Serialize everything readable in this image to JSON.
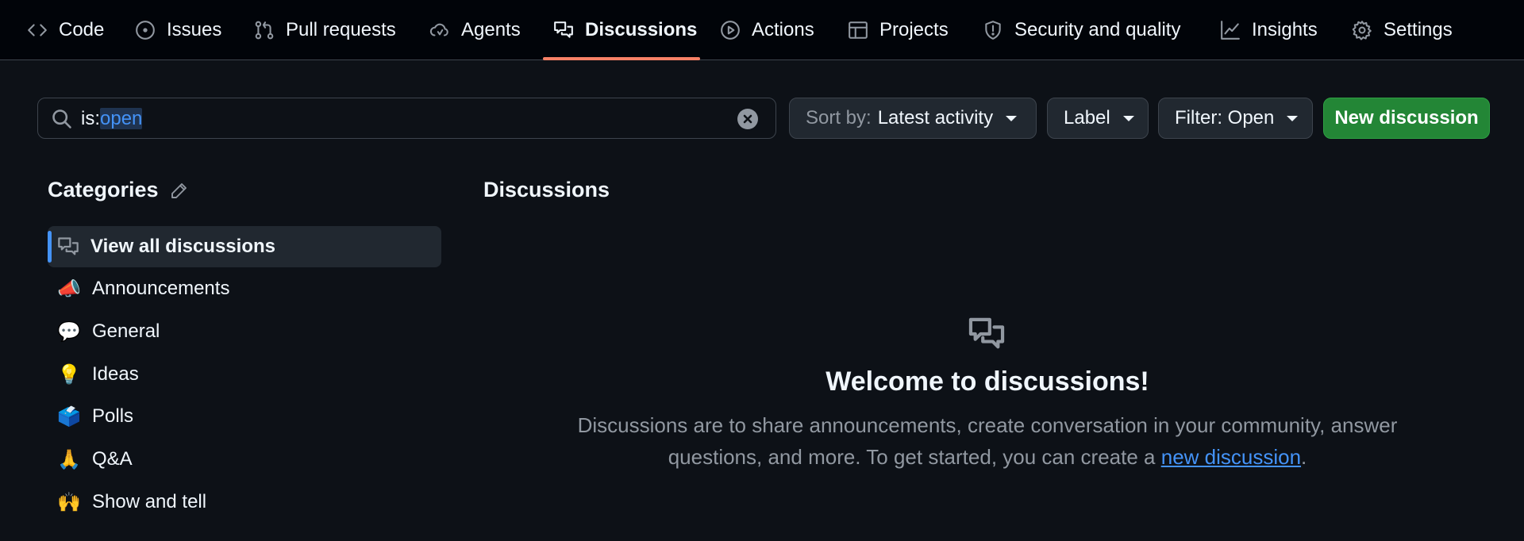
{
  "repo_nav": {
    "tabs": [
      {
        "label": "Code",
        "icon": "code-icon"
      },
      {
        "label": "Issues",
        "icon": "issue-opened-icon"
      },
      {
        "label": "Pull requests",
        "icon": "git-pull-request-icon"
      },
      {
        "label": "Agents",
        "icon": "agent-cloud-icon"
      },
      {
        "label": "Discussions",
        "icon": "comment-discussion-icon",
        "active": true
      },
      {
        "label": "Actions",
        "icon": "play-icon"
      },
      {
        "label": "Projects",
        "icon": "table-icon"
      },
      {
        "label": "Security and quality",
        "icon": "shield-icon"
      },
      {
        "label": "Insights",
        "icon": "graph-icon"
      },
      {
        "label": "Settings",
        "icon": "gear-icon"
      }
    ]
  },
  "search": {
    "prefix": "is:",
    "highlighted": "open"
  },
  "toolbar": {
    "sort_prefix": "Sort by:",
    "sort_value": "Latest activity",
    "label_button": "Label",
    "filter_button": "Filter: Open",
    "new_discussion_button": "New discussion"
  },
  "sidebar": {
    "title": "Categories",
    "items": [
      {
        "label": "View all discussions",
        "icon": "comment-discussion-icon",
        "active": true
      },
      {
        "label": "Announcements",
        "emoji": "📣"
      },
      {
        "label": "General",
        "emoji": "💬"
      },
      {
        "label": "Ideas",
        "emoji": "💡"
      },
      {
        "label": "Polls",
        "emoji": "🗳️"
      },
      {
        "label": "Q&A",
        "emoji": "🙏"
      },
      {
        "label": "Show and tell",
        "emoji": "🙌"
      }
    ]
  },
  "main": {
    "title": "Discussions",
    "welcome_title": "Welcome to discussions!",
    "description_before": "Discussions are to share announcements, create conversation in your community, answer questions, and more. To get started, you can create a ",
    "description_link": "new discussion",
    "description_after": "."
  },
  "colors": {
    "background": "#0d1117",
    "nav_background": "#010409",
    "accent_underline": "#f78166",
    "link": "#4493f8",
    "primary_button": "#238636"
  }
}
